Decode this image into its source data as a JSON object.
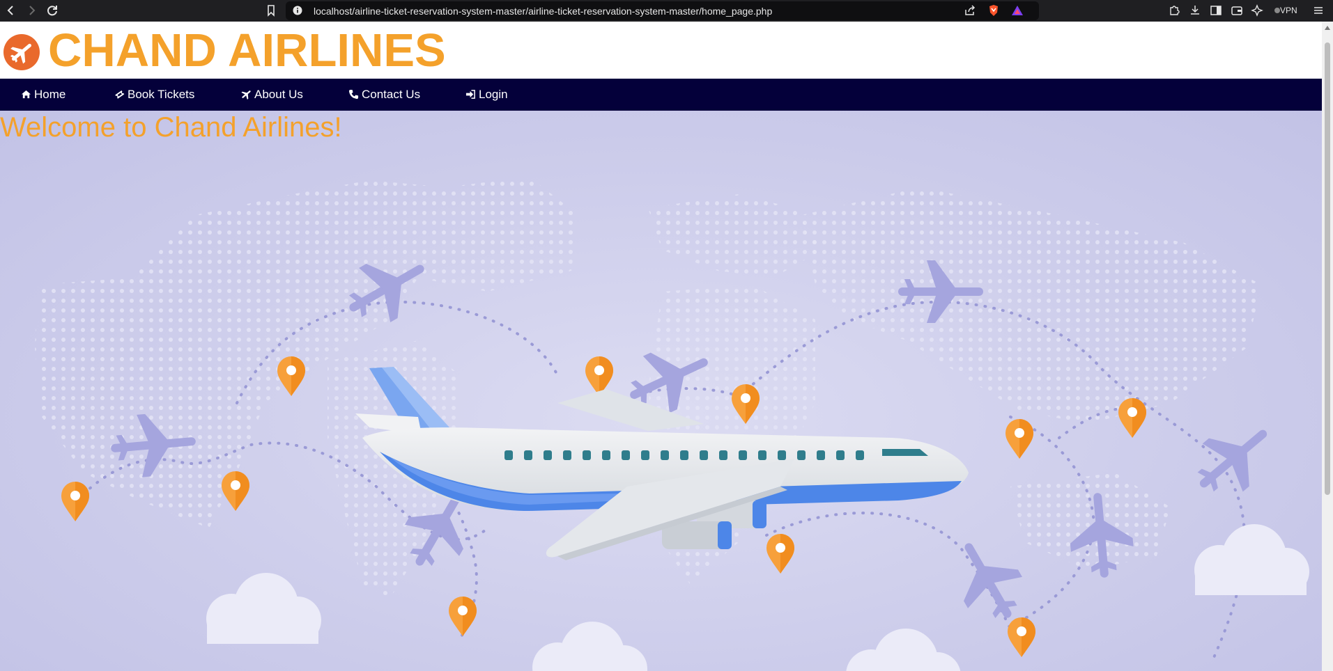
{
  "browser": {
    "url": "localhost/airline-ticket-reservation-system-master/airline-ticket-reservation-system-master/home_page.php",
    "vpn_label": "VPN"
  },
  "site": {
    "title": "CHAND AIRLINES",
    "logo_icon": "airplane-icon",
    "brand_color": "#f4a12b",
    "nav_color": "#04003a"
  },
  "nav": {
    "items": [
      {
        "label": "Home",
        "icon": "home-icon"
      },
      {
        "label": "Book Tickets",
        "icon": "ticket-icon"
      },
      {
        "label": "About Us",
        "icon": "plane-icon"
      },
      {
        "label": "Contact Us",
        "icon": "phone-icon"
      },
      {
        "label": "Login",
        "icon": "sign-in-icon"
      }
    ]
  },
  "hero": {
    "welcome": "Welcome to Chand Airlines!",
    "illustration": "airplane-over-world-map-illustration"
  }
}
